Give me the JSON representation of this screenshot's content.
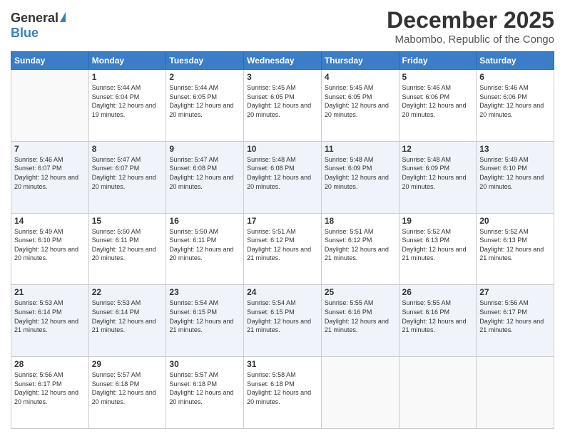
{
  "logo": {
    "general": "General",
    "blue": "Blue"
  },
  "header": {
    "month": "December 2025",
    "location": "Mabombo, Republic of the Congo"
  },
  "weekdays": [
    "Sunday",
    "Monday",
    "Tuesday",
    "Wednesday",
    "Thursday",
    "Friday",
    "Saturday"
  ],
  "weeks": [
    [
      {
        "day": "",
        "sunrise": "",
        "sunset": "",
        "daylight": ""
      },
      {
        "day": "1",
        "sunrise": "Sunrise: 5:44 AM",
        "sunset": "Sunset: 6:04 PM",
        "daylight": "Daylight: 12 hours and 19 minutes."
      },
      {
        "day": "2",
        "sunrise": "Sunrise: 5:44 AM",
        "sunset": "Sunset: 6:05 PM",
        "daylight": "Daylight: 12 hours and 20 minutes."
      },
      {
        "day": "3",
        "sunrise": "Sunrise: 5:45 AM",
        "sunset": "Sunset: 6:05 PM",
        "daylight": "Daylight: 12 hours and 20 minutes."
      },
      {
        "day": "4",
        "sunrise": "Sunrise: 5:45 AM",
        "sunset": "Sunset: 6:05 PM",
        "daylight": "Daylight: 12 hours and 20 minutes."
      },
      {
        "day": "5",
        "sunrise": "Sunrise: 5:46 AM",
        "sunset": "Sunset: 6:06 PM",
        "daylight": "Daylight: 12 hours and 20 minutes."
      },
      {
        "day": "6",
        "sunrise": "Sunrise: 5:46 AM",
        "sunset": "Sunset: 6:06 PM",
        "daylight": "Daylight: 12 hours and 20 minutes."
      }
    ],
    [
      {
        "day": "7",
        "sunrise": "Sunrise: 5:46 AM",
        "sunset": "Sunset: 6:07 PM",
        "daylight": "Daylight: 12 hours and 20 minutes."
      },
      {
        "day": "8",
        "sunrise": "Sunrise: 5:47 AM",
        "sunset": "Sunset: 6:07 PM",
        "daylight": "Daylight: 12 hours and 20 minutes."
      },
      {
        "day": "9",
        "sunrise": "Sunrise: 5:47 AM",
        "sunset": "Sunset: 6:08 PM",
        "daylight": "Daylight: 12 hours and 20 minutes."
      },
      {
        "day": "10",
        "sunrise": "Sunrise: 5:48 AM",
        "sunset": "Sunset: 6:08 PM",
        "daylight": "Daylight: 12 hours and 20 minutes."
      },
      {
        "day": "11",
        "sunrise": "Sunrise: 5:48 AM",
        "sunset": "Sunset: 6:09 PM",
        "daylight": "Daylight: 12 hours and 20 minutes."
      },
      {
        "day": "12",
        "sunrise": "Sunrise: 5:48 AM",
        "sunset": "Sunset: 6:09 PM",
        "daylight": "Daylight: 12 hours and 20 minutes."
      },
      {
        "day": "13",
        "sunrise": "Sunrise: 5:49 AM",
        "sunset": "Sunset: 6:10 PM",
        "daylight": "Daylight: 12 hours and 20 minutes."
      }
    ],
    [
      {
        "day": "14",
        "sunrise": "Sunrise: 5:49 AM",
        "sunset": "Sunset: 6:10 PM",
        "daylight": "Daylight: 12 hours and 20 minutes."
      },
      {
        "day": "15",
        "sunrise": "Sunrise: 5:50 AM",
        "sunset": "Sunset: 6:11 PM",
        "daylight": "Daylight: 12 hours and 20 minutes."
      },
      {
        "day": "16",
        "sunrise": "Sunrise: 5:50 AM",
        "sunset": "Sunset: 6:11 PM",
        "daylight": "Daylight: 12 hours and 20 minutes."
      },
      {
        "day": "17",
        "sunrise": "Sunrise: 5:51 AM",
        "sunset": "Sunset: 6:12 PM",
        "daylight": "Daylight: 12 hours and 21 minutes."
      },
      {
        "day": "18",
        "sunrise": "Sunrise: 5:51 AM",
        "sunset": "Sunset: 6:12 PM",
        "daylight": "Daylight: 12 hours and 21 minutes."
      },
      {
        "day": "19",
        "sunrise": "Sunrise: 5:52 AM",
        "sunset": "Sunset: 6:13 PM",
        "daylight": "Daylight: 12 hours and 21 minutes."
      },
      {
        "day": "20",
        "sunrise": "Sunrise: 5:52 AM",
        "sunset": "Sunset: 6:13 PM",
        "daylight": "Daylight: 12 hours and 21 minutes."
      }
    ],
    [
      {
        "day": "21",
        "sunrise": "Sunrise: 5:53 AM",
        "sunset": "Sunset: 6:14 PM",
        "daylight": "Daylight: 12 hours and 21 minutes."
      },
      {
        "day": "22",
        "sunrise": "Sunrise: 5:53 AM",
        "sunset": "Sunset: 6:14 PM",
        "daylight": "Daylight: 12 hours and 21 minutes."
      },
      {
        "day": "23",
        "sunrise": "Sunrise: 5:54 AM",
        "sunset": "Sunset: 6:15 PM",
        "daylight": "Daylight: 12 hours and 21 minutes."
      },
      {
        "day": "24",
        "sunrise": "Sunrise: 5:54 AM",
        "sunset": "Sunset: 6:15 PM",
        "daylight": "Daylight: 12 hours and 21 minutes."
      },
      {
        "day": "25",
        "sunrise": "Sunrise: 5:55 AM",
        "sunset": "Sunset: 6:16 PM",
        "daylight": "Daylight: 12 hours and 21 minutes."
      },
      {
        "day": "26",
        "sunrise": "Sunrise: 5:55 AM",
        "sunset": "Sunset: 6:16 PM",
        "daylight": "Daylight: 12 hours and 21 minutes."
      },
      {
        "day": "27",
        "sunrise": "Sunrise: 5:56 AM",
        "sunset": "Sunset: 6:17 PM",
        "daylight": "Daylight: 12 hours and 21 minutes."
      }
    ],
    [
      {
        "day": "28",
        "sunrise": "Sunrise: 5:56 AM",
        "sunset": "Sunset: 6:17 PM",
        "daylight": "Daylight: 12 hours and 20 minutes."
      },
      {
        "day": "29",
        "sunrise": "Sunrise: 5:57 AM",
        "sunset": "Sunset: 6:18 PM",
        "daylight": "Daylight: 12 hours and 20 minutes."
      },
      {
        "day": "30",
        "sunrise": "Sunrise: 5:57 AM",
        "sunset": "Sunset: 6:18 PM",
        "daylight": "Daylight: 12 hours and 20 minutes."
      },
      {
        "day": "31",
        "sunrise": "Sunrise: 5:58 AM",
        "sunset": "Sunset: 6:18 PM",
        "daylight": "Daylight: 12 hours and 20 minutes."
      },
      {
        "day": "",
        "sunrise": "",
        "sunset": "",
        "daylight": ""
      },
      {
        "day": "",
        "sunrise": "",
        "sunset": "",
        "daylight": ""
      },
      {
        "day": "",
        "sunrise": "",
        "sunset": "",
        "daylight": ""
      }
    ]
  ]
}
